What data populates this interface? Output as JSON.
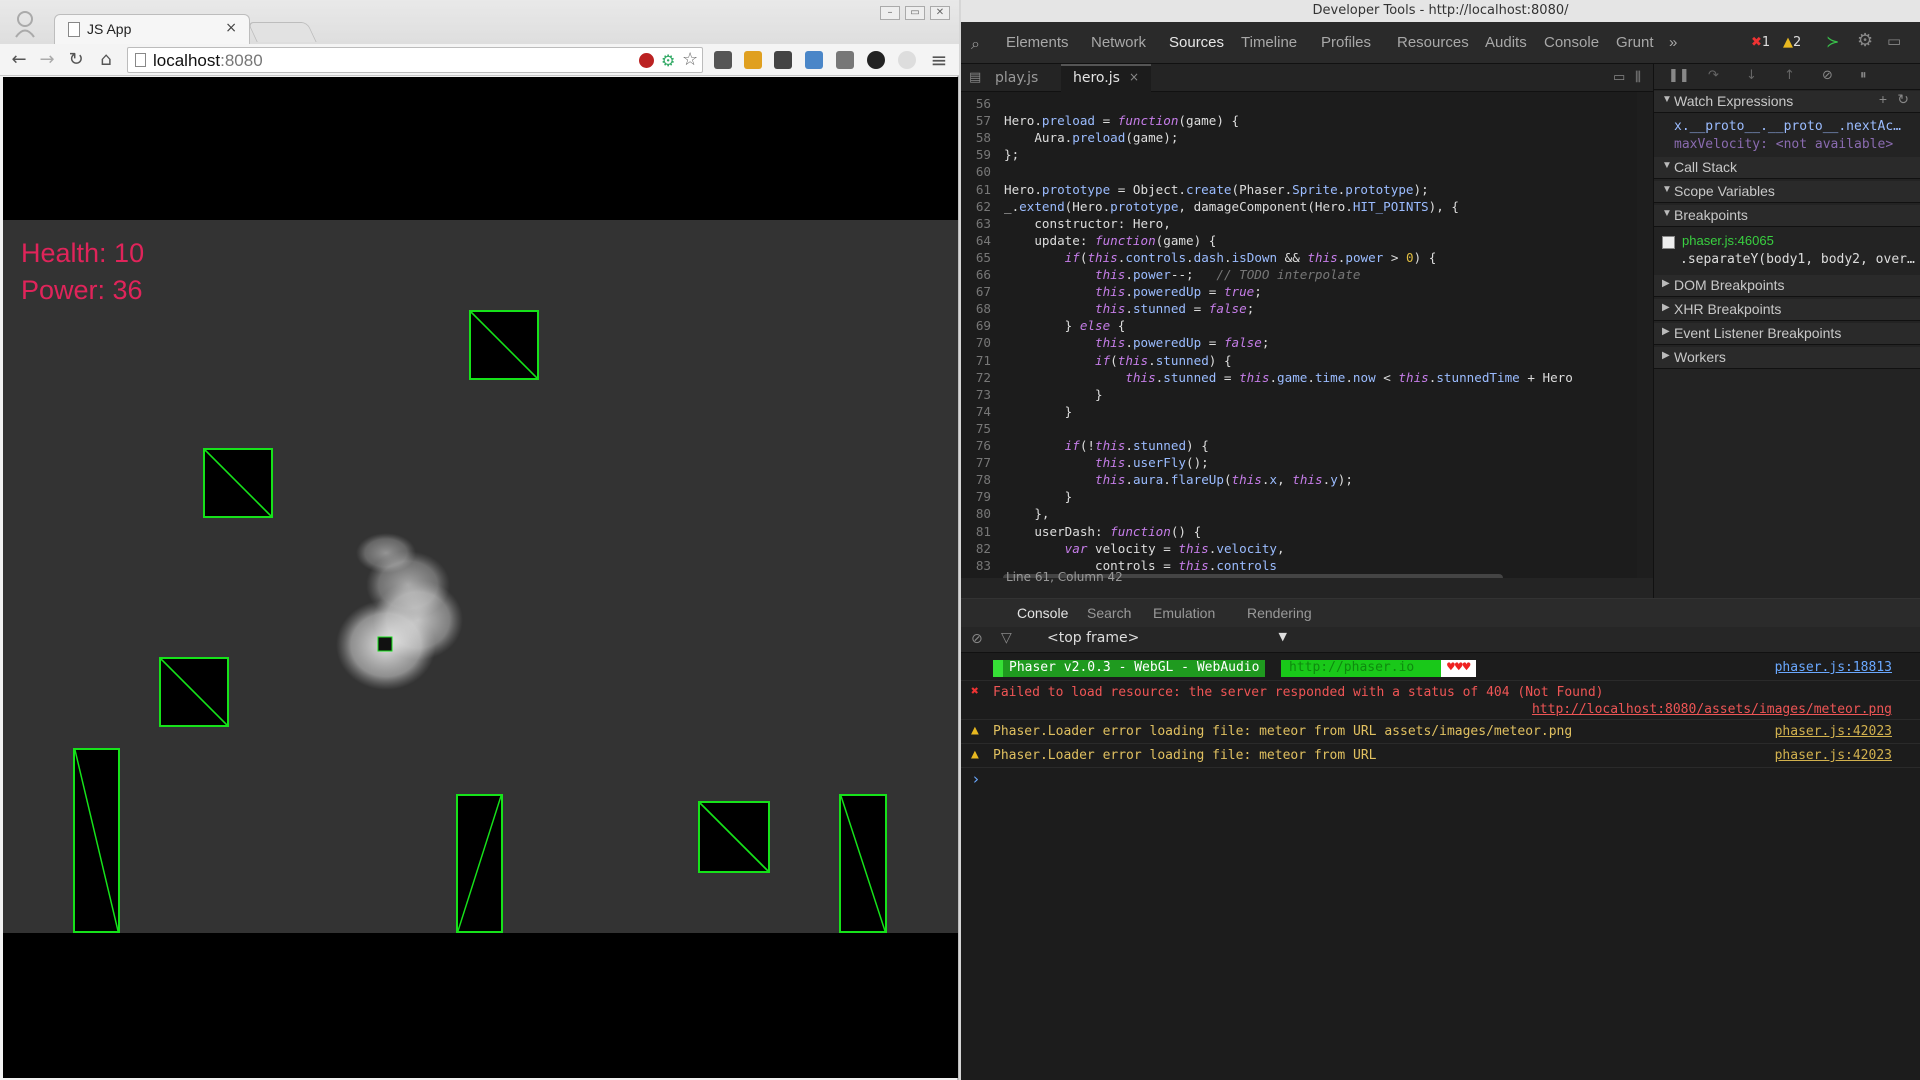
{
  "browser": {
    "tab": {
      "title": "JS App",
      "close": "×"
    },
    "window_buttons": [
      "–",
      "▭",
      "✕"
    ],
    "url": {
      "host": "localhost",
      "port": ":8080"
    }
  },
  "game": {
    "health_label": "Health: 10",
    "power_label": "Power: 36"
  },
  "devtools": {
    "window_title": "Developer Tools - http://localhost:8080/",
    "tabs": [
      "Elements",
      "Network",
      "Sources",
      "Timeline",
      "Profiles",
      "Resources",
      "Audits",
      "Console",
      "Grunt"
    ],
    "more": "»",
    "errors_count": "1",
    "warnings_count": "2",
    "file_tabs": [
      "play.js",
      "hero.js"
    ],
    "file_close": "×",
    "code_lines": [
      {
        "n": "56",
        "t": ""
      },
      {
        "n": "57",
        "t": "Hero.preload = function(game) {"
      },
      {
        "n": "58",
        "t": "    Aura.preload(game);"
      },
      {
        "n": "59",
        "t": "};"
      },
      {
        "n": "60",
        "t": ""
      },
      {
        "n": "61",
        "t": "Hero.prototype = Object.create(Phaser.Sprite.prototype);"
      },
      {
        "n": "62",
        "t": "_.extend(Hero.prototype, damageComponent(Hero.HIT_POINTS), {"
      },
      {
        "n": "63",
        "t": "    constructor: Hero,"
      },
      {
        "n": "64",
        "t": "    update: function(game) {"
      },
      {
        "n": "65",
        "t": "        if(this.controls.dash.isDown && this.power > 0) {"
      },
      {
        "n": "66",
        "t": "            this.power--;   // TODO interpolate"
      },
      {
        "n": "67",
        "t": "            this.poweredUp = true;"
      },
      {
        "n": "68",
        "t": "            this.stunned = false;"
      },
      {
        "n": "69",
        "t": "        } else {"
      },
      {
        "n": "70",
        "t": "            this.poweredUp = false;"
      },
      {
        "n": "71",
        "t": "            if(this.stunned) {"
      },
      {
        "n": "72",
        "t": "                this.stunned = this.game.time.now < this.stunnedTime + Hero"
      },
      {
        "n": "73",
        "t": "            }"
      },
      {
        "n": "74",
        "t": "        }"
      },
      {
        "n": "75",
        "t": ""
      },
      {
        "n": "76",
        "t": "        if(!this.stunned) {"
      },
      {
        "n": "77",
        "t": "            this.userFly();"
      },
      {
        "n": "78",
        "t": "            this.aura.flareUp(this.x, this.y);"
      },
      {
        "n": "79",
        "t": "        }"
      },
      {
        "n": "80",
        "t": "    },"
      },
      {
        "n": "81",
        "t": "    userDash: function() {"
      },
      {
        "n": "82",
        "t": "        var velocity = this.velocity,"
      },
      {
        "n": "83",
        "t": "            controls = this.controls"
      }
    ],
    "status": "Line 61, Column 42",
    "right_sections": {
      "watch": "Watch Expressions",
      "watch_items": [
        "x.__proto__.__proto__.nextAc…",
        "maxVelocity: <not available>"
      ],
      "callstack": "Call Stack",
      "scope": "Scope Variables",
      "breakpoints": "Breakpoints",
      "bp_file": "phaser.js:46065",
      "bp_code": ".separateY(body1, body2, over…",
      "dom": "DOM Breakpoints",
      "xhr": "XHR Breakpoints",
      "event": "Event Listener Breakpoints",
      "workers": "Workers"
    },
    "drawer_tabs": [
      "Console",
      "Search",
      "Emulation",
      "Rendering"
    ],
    "frame": "<top frame>",
    "console": {
      "banner": "Phaser v2.0.3 - WebGL - WebAudio",
      "banner_link": "http://phaser.io",
      "banner_hearts": "♥♥♥",
      "banner_src": "phaser.js:18813",
      "err_text": "Failed to load resource: the server responded with a status of 404 (Not Found)",
      "err_link": "http://localhost:8080/assets/images/meteor.png",
      "warn1": "Phaser.Loader error loading file: meteor from URL assets/images/meteor.png",
      "warn1_src": "phaser.js:42023",
      "warn2": "Phaser.Loader error loading file: meteor from URL",
      "warn2_src": "phaser.js:42023",
      "prompt": "›"
    }
  }
}
